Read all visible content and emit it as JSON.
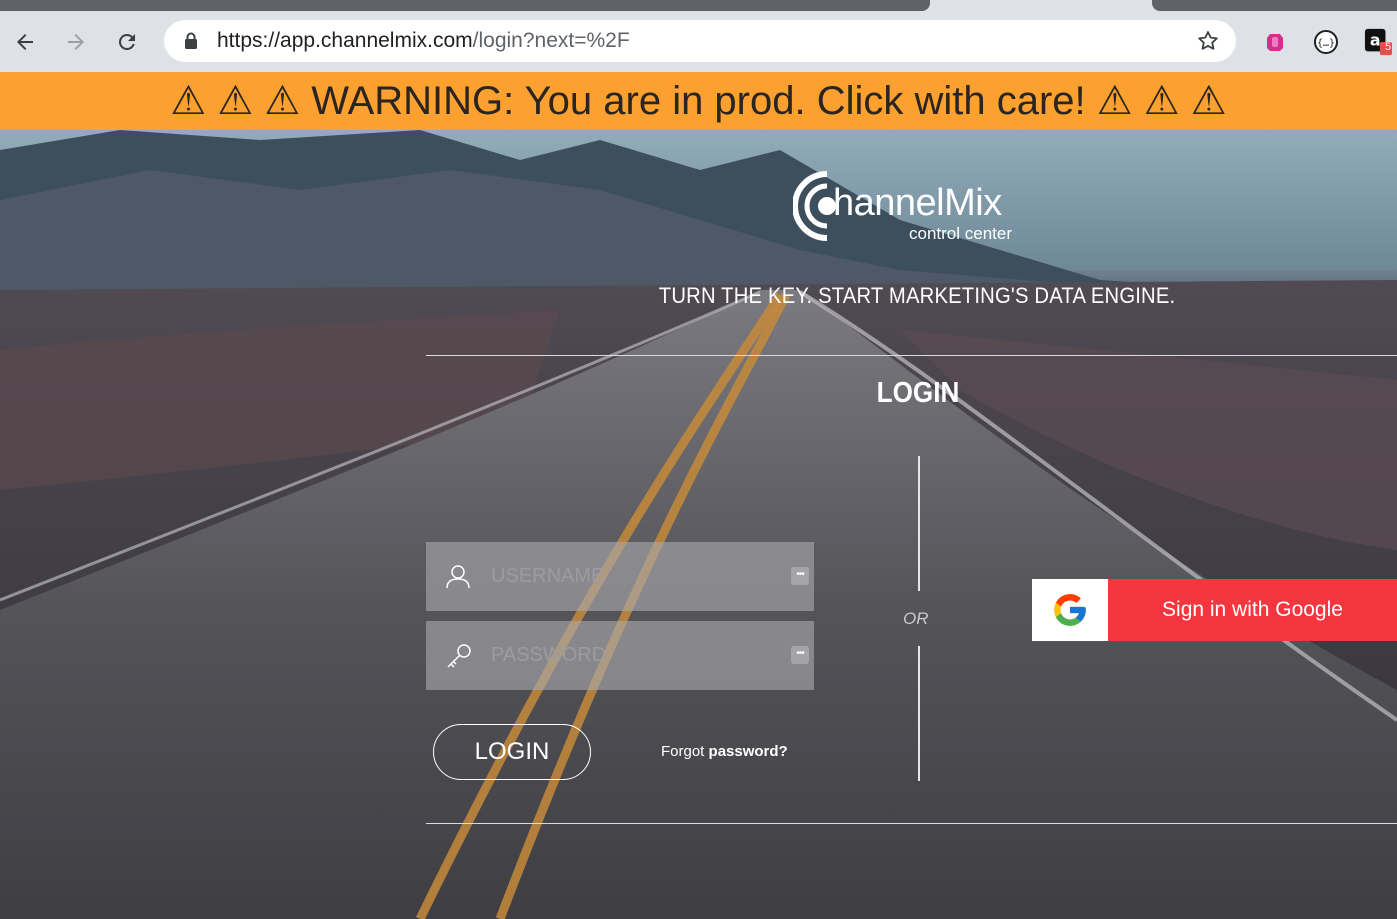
{
  "browser": {
    "url_host": "https://app.channelmix.com",
    "url_path": "/login?next=%2F",
    "extension_badge": "5"
  },
  "banner": {
    "text": "⚠ ⚠ ⚠ WARNING: You are in prod. Click with care! ⚠ ⚠ ⚠",
    "color": "#fca02f"
  },
  "brand": {
    "logo_main": "hannelMix",
    "logo_sub": "control center",
    "tagline": "TURN THE KEY. START MARKETING'S DATA ENGINE."
  },
  "login": {
    "title": "LOGIN",
    "username_placeholder": "USERNAME",
    "password_placeholder": "PASSWORD",
    "submit_label": "LOGIN",
    "forgot_prefix": "Forgot",
    "forgot_link": "password?",
    "or_label": "OR",
    "google_label": "Sign in with Google",
    "google_color": "#f6363f"
  },
  "icons": {
    "back": "arrow-left-icon",
    "forward": "arrow-right-icon",
    "reload": "reload-icon",
    "lock": "lock-icon",
    "bookmark": "star-icon",
    "user": "user-icon",
    "key": "key-icon",
    "google": "google-g-icon"
  }
}
